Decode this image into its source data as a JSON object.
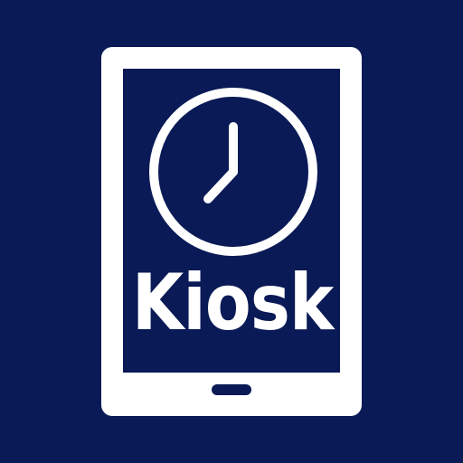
{
  "icon": {
    "label": "Kiosk",
    "symbol_icons": [
      "tablet-icon",
      "clock-icon"
    ],
    "colors": {
      "background": "#0a1a56",
      "foreground": "#ffffff"
    }
  }
}
